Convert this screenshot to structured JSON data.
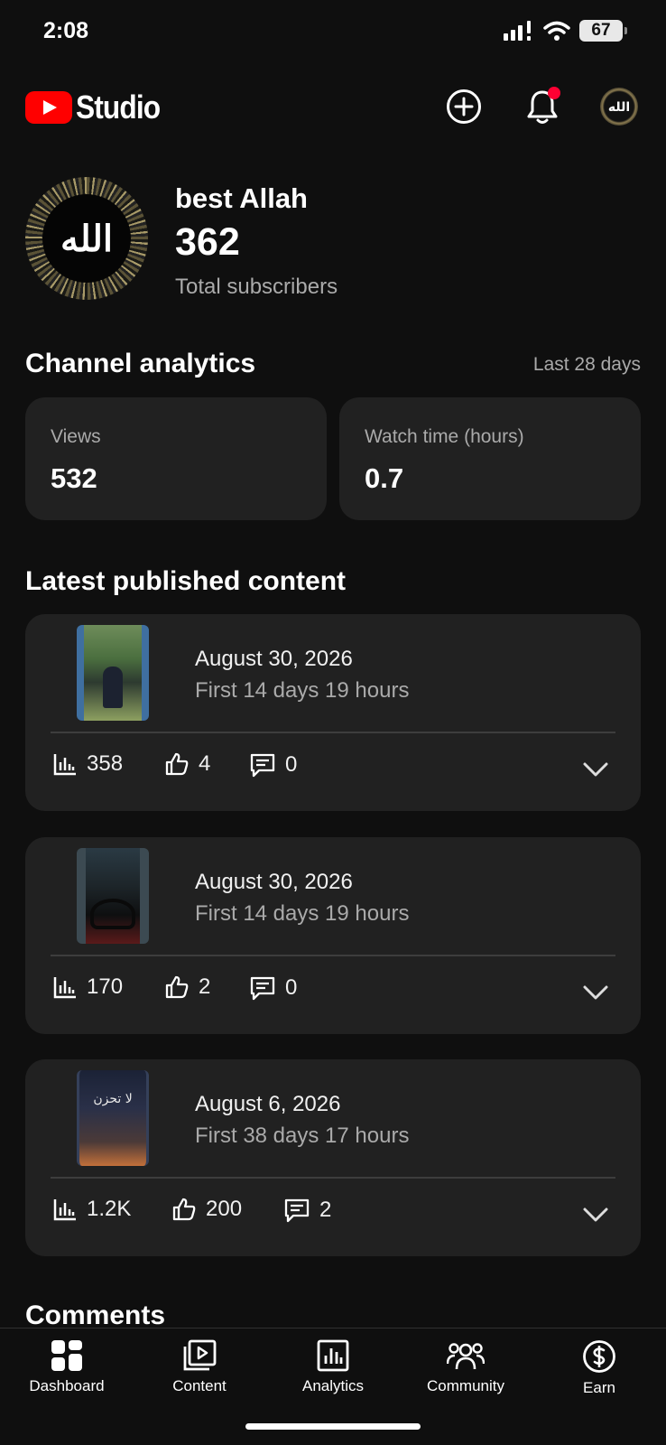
{
  "status_bar": {
    "time": "2:08",
    "battery": "67"
  },
  "header": {
    "logo_text": "Studio",
    "brand_color": "#ff0000",
    "icons": [
      "add-circle-icon",
      "bell-icon",
      "avatar"
    ]
  },
  "channel": {
    "name": "best Allah",
    "avatar_text": "الله",
    "subscribers": "362",
    "subscribers_label": "Total subscribers"
  },
  "analytics": {
    "title": "Channel analytics",
    "range": "Last 28 days",
    "stats": [
      {
        "label": "Views",
        "value": "532"
      },
      {
        "label": "Watch time (hours)",
        "value": "0.7"
      }
    ]
  },
  "latest": {
    "title": "Latest published content",
    "items": [
      {
        "date": "August 30, 2026",
        "period": "First 14 days 19 hours",
        "views": "358",
        "likes": "4",
        "comments": "0"
      },
      {
        "date": "August 30, 2026",
        "period": "First 14 days 19 hours",
        "views": "170",
        "likes": "2",
        "comments": "0"
      },
      {
        "date": "August 6, 2026",
        "period": "First 38 days 17 hours",
        "views": "1.2K",
        "likes": "200",
        "comments": "2",
        "thumb_text": "لا تحزن"
      }
    ]
  },
  "comments": {
    "title": "Comments"
  },
  "nav": [
    {
      "label": "Dashboard"
    },
    {
      "label": "Content"
    },
    {
      "label": "Analytics"
    },
    {
      "label": "Community"
    },
    {
      "label": "Earn"
    }
  ]
}
